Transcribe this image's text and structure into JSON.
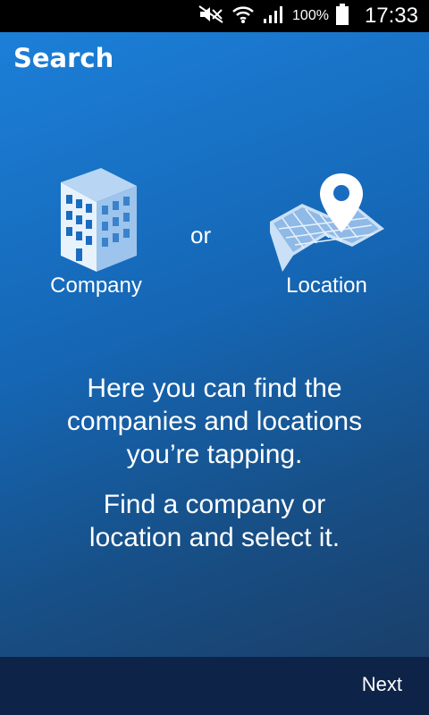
{
  "status_bar": {
    "battery_percent": "100%",
    "time": "17:33",
    "icons": [
      "mute-icon",
      "wifi-icon",
      "signal-icon",
      "battery-icon"
    ]
  },
  "header": {
    "title": "Search"
  },
  "options": {
    "company": {
      "label": "Company",
      "icon": "building-icon"
    },
    "separator": "or",
    "location": {
      "label": "Location",
      "icon": "map-pin-icon"
    }
  },
  "intro": {
    "line1": "Here you can find the",
    "line2": "companies and locations",
    "line3": "you’re tapping.",
    "line4": "Find a company or",
    "line5": "location and select it."
  },
  "footer": {
    "next_label": "Next"
  },
  "colors": {
    "gradient_start": "#1c7fd8",
    "gradient_end": "#1a3f6a",
    "bottom_bar": "#0d2347"
  }
}
